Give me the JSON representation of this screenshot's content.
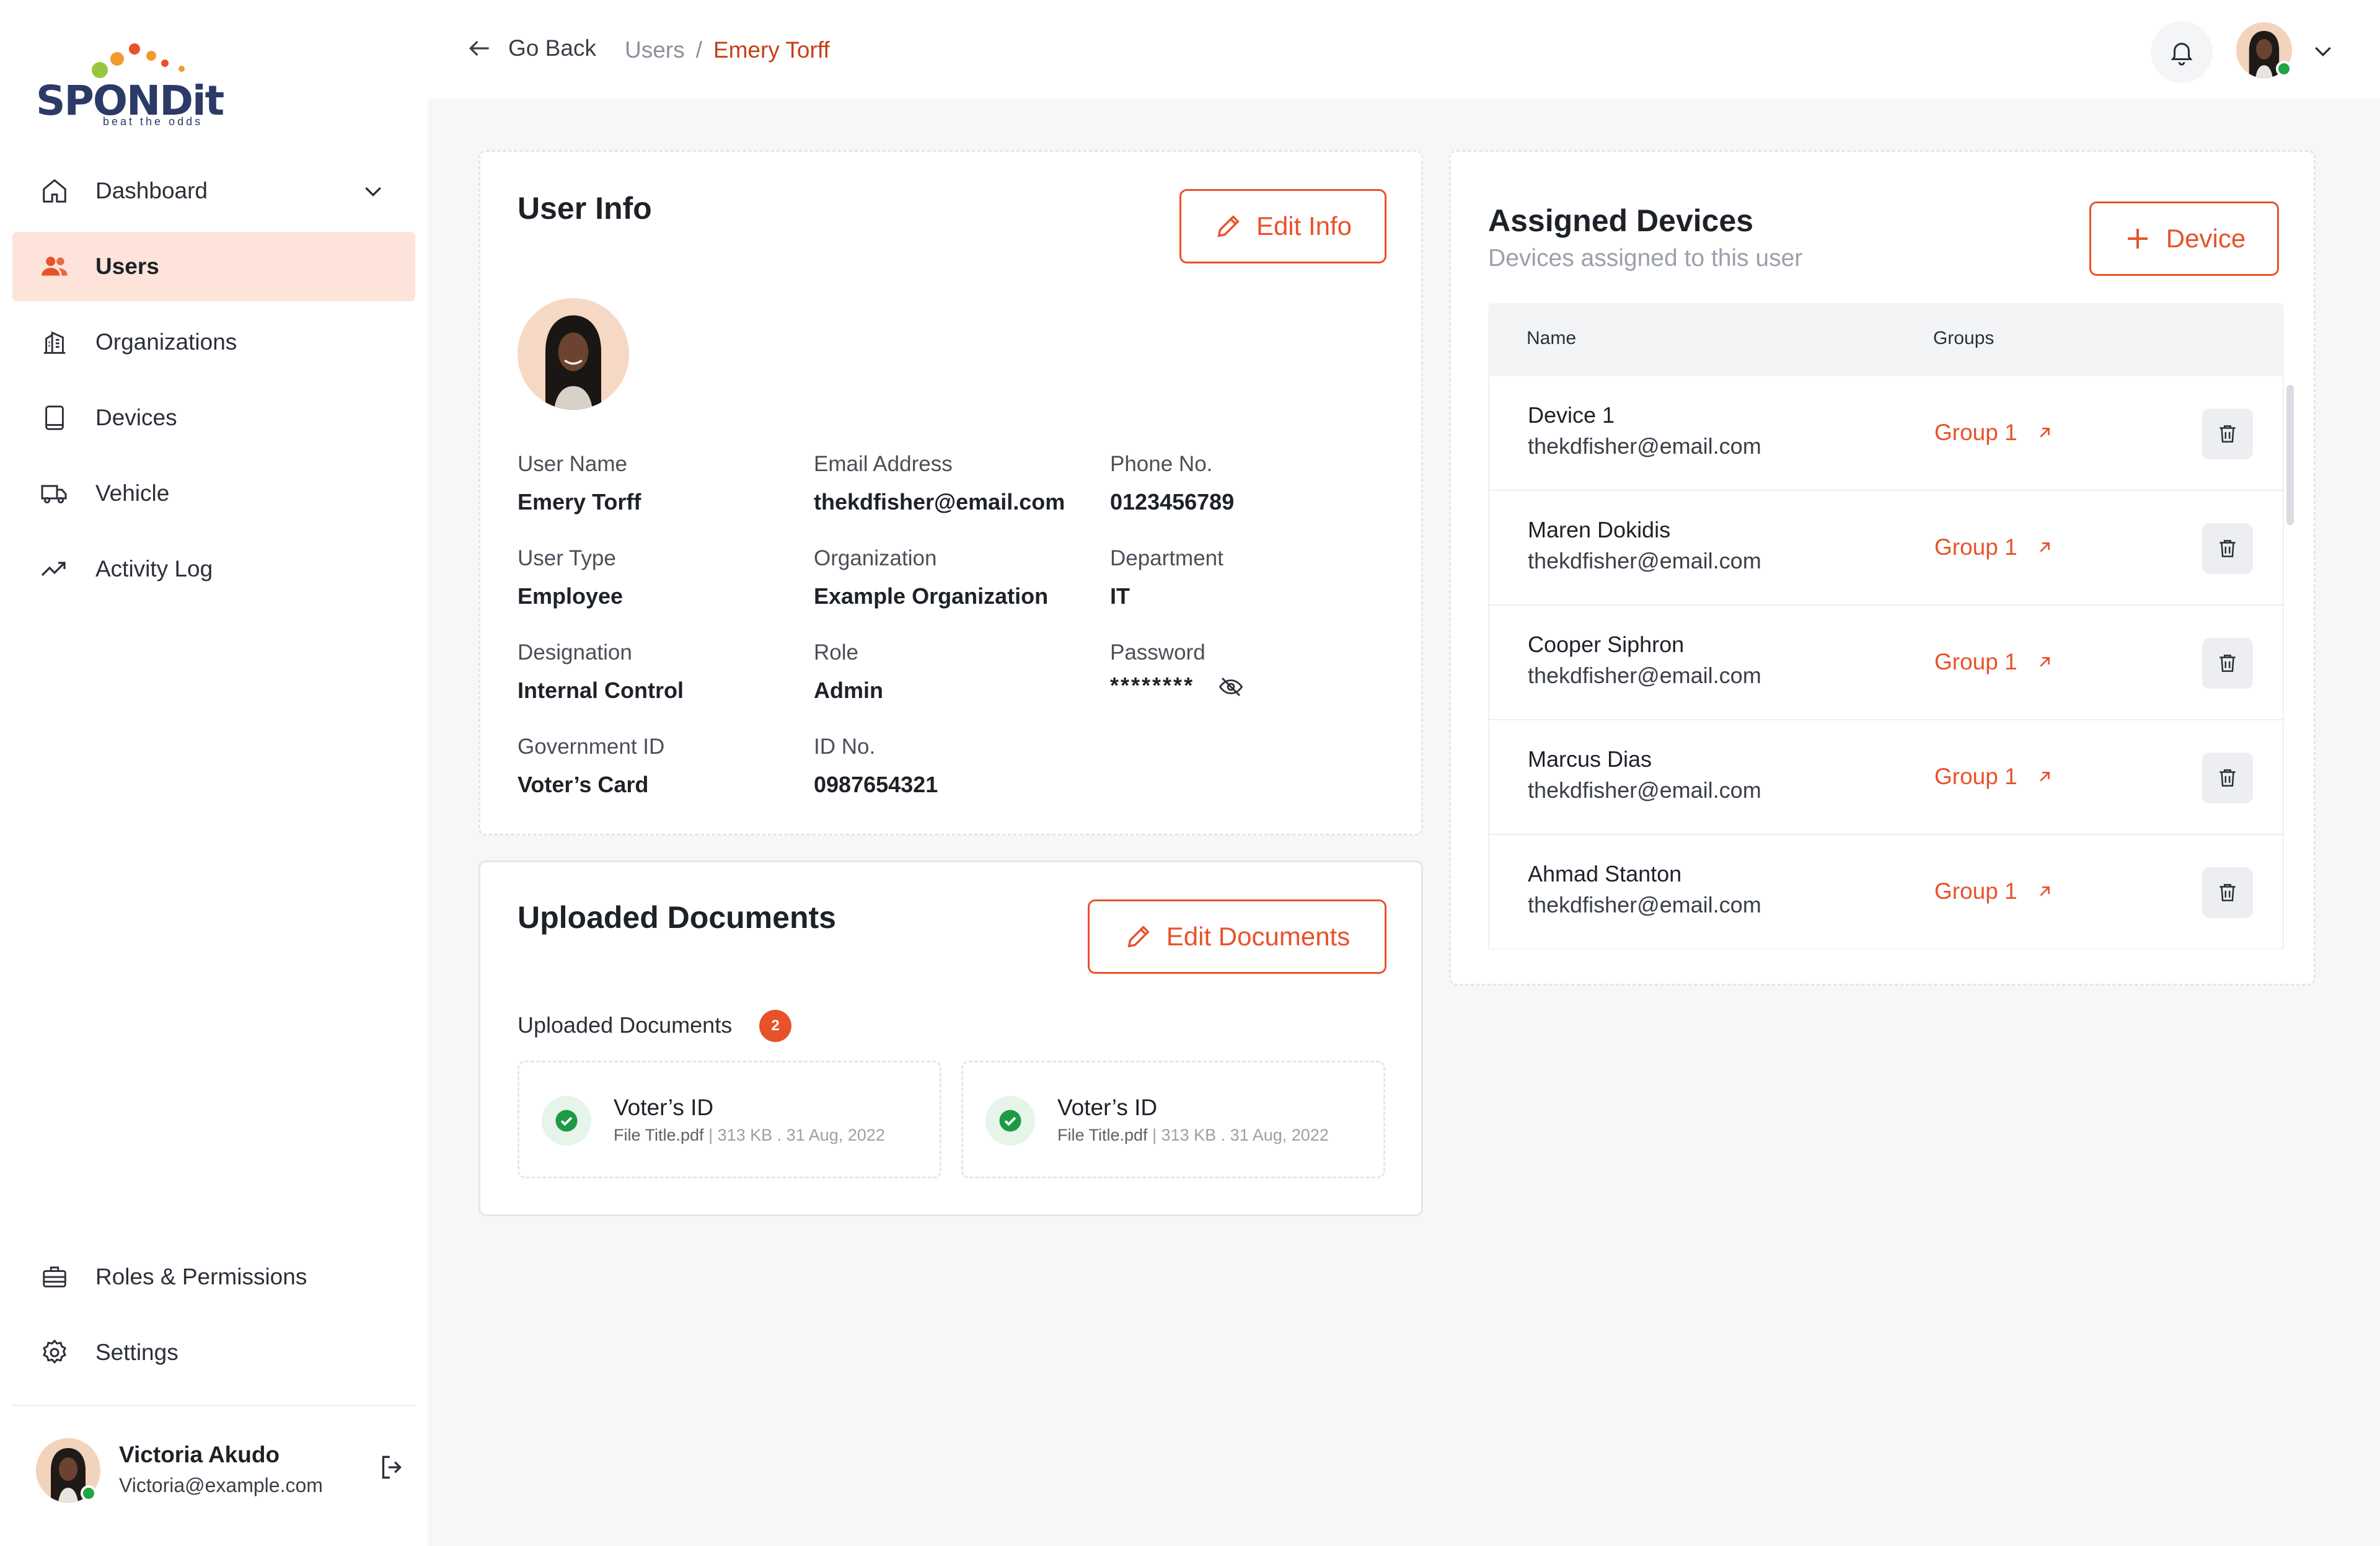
{
  "brand": {
    "name": "SPONDit",
    "tagline": "beat the odds"
  },
  "sidebar": {
    "items": [
      {
        "label": "Dashboard",
        "icon": "home-icon"
      },
      {
        "label": "Users",
        "icon": "users-icon",
        "active": true
      },
      {
        "label": "Organizations",
        "icon": "building-icon"
      },
      {
        "label": "Devices",
        "icon": "tablet-icon"
      },
      {
        "label": "Vehicle",
        "icon": "truck-icon"
      },
      {
        "label": "Activity Log",
        "icon": "trending-icon"
      }
    ],
    "bottom_items": [
      {
        "label": "Roles & Permissions",
        "icon": "briefcase-icon"
      },
      {
        "label": "Settings",
        "icon": "gear-icon"
      }
    ],
    "profile": {
      "name": "Victoria Akudo",
      "email": "Victoria@example.com"
    }
  },
  "topbar": {
    "back_label": "Go Back",
    "breadcrumb": [
      "Users",
      "Emery Torff"
    ]
  },
  "user_info": {
    "title": "User Info",
    "edit_label": "Edit Info",
    "fields": [
      {
        "label": "User Name",
        "value": "Emery Torff"
      },
      {
        "label": "Email Address",
        "value": "thekdfisher@email.com"
      },
      {
        "label": "Phone No.",
        "value": "0123456789"
      },
      {
        "label": "User Type",
        "value": "Employee"
      },
      {
        "label": "Organization",
        "value": "Example Organization"
      },
      {
        "label": "Department",
        "value": "IT"
      },
      {
        "label": "Designation",
        "value": "Internal Control"
      },
      {
        "label": "Role",
        "value": "Admin"
      },
      {
        "label": "Password",
        "value": "********"
      },
      {
        "label": "Government ID",
        "value": "Voter’s Card"
      },
      {
        "label": "ID No.",
        "value": "0987654321"
      }
    ]
  },
  "documents": {
    "title": "Uploaded Documents",
    "edit_label": "Edit Documents",
    "list_label": "Uploaded Documents",
    "count": "2",
    "items": [
      {
        "title": "Voter’s ID",
        "file": "File Title.pdf",
        "meta": "313 KB . 31 Aug, 2022"
      },
      {
        "title": "Voter’s ID",
        "file": "File Title.pdf",
        "meta": "313 KB . 31 Aug, 2022"
      }
    ]
  },
  "devices": {
    "title": "Assigned Devices",
    "subtitle": "Devices assigned to this user",
    "add_label": "Device",
    "columns": [
      "Name",
      "Groups"
    ],
    "rows": [
      {
        "name": "Device 1",
        "email": "thekdfisher@email.com",
        "group": "Group 1"
      },
      {
        "name": "Maren Dokidis",
        "email": "thekdfisher@email.com",
        "group": "Group 1"
      },
      {
        "name": "Cooper Siphron",
        "email": "thekdfisher@email.com",
        "group": "Group 1"
      },
      {
        "name": "Marcus Dias",
        "email": "thekdfisher@email.com",
        "group": "Group 1"
      },
      {
        "name": "Ahmad Stanton",
        "email": "thekdfisher@email.com",
        "group": "Group 1"
      }
    ]
  },
  "colors": {
    "accent": "#e8522a",
    "active_bg": "#fde3d9",
    "online": "#22a447"
  }
}
